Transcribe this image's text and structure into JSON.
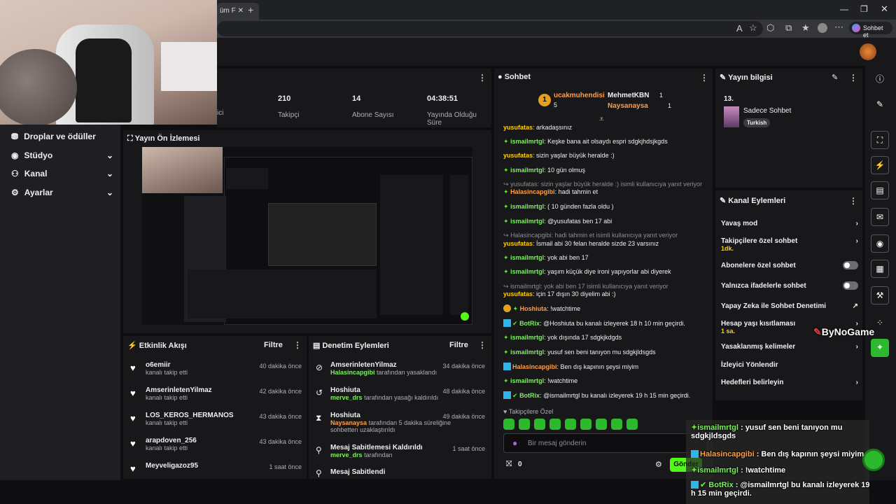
{
  "browser": {
    "tab_label": "üm F",
    "search_label": "Sohbet et"
  },
  "stream_stats": {
    "title_fragment": "ici",
    "items": [
      {
        "value": "210",
        "label": "Takipçi"
      },
      {
        "value": "14",
        "label": "Abone Sayısı"
      },
      {
        "value": "04:38:51",
        "label": "Yayında Olduğu Süre"
      }
    ]
  },
  "sidebar": {
    "items": [
      {
        "label": "Droplar ve ödüller"
      },
      {
        "label": "Stüdyo"
      },
      {
        "label": "Kanal"
      },
      {
        "label": "Ayarlar"
      }
    ]
  },
  "preview": {
    "title": "Yayın Ön İzlemesi"
  },
  "activity": {
    "title": "Etkinlik Akışı",
    "filter": "Filtre",
    "items": [
      {
        "name": "o6emiir",
        "sub": "kanalı takip etti",
        "time": "40 dakika önce"
      },
      {
        "name": "AmserinletenYilmaz",
        "sub": "kanalı takip etti",
        "time": "42 dakika önce"
      },
      {
        "name": "LOS_KEROS_HERMANOS",
        "sub": "kanalı takip etti",
        "time": "43 dakika önce"
      },
      {
        "name": "arapdoven_256",
        "sub": "kanalı takip etti",
        "time": "43 dakika önce"
      },
      {
        "name": "Meyveligazoz95",
        "sub": "kanalı takip etti",
        "time": "1 saat önce"
      }
    ]
  },
  "moderation": {
    "title": "Denetim Eylemleri",
    "filter": "Filtre",
    "items": [
      {
        "name": "AmserinletenYilmaz",
        "by": "Halasincapgibi",
        "sub": "tarafından yasaklandı",
        "time": "34 dakika önce"
      },
      {
        "name": "Hoshiuta",
        "by": "merve_drs",
        "sub": "tarafından yasağı kaldırıldı",
        "time": "48 dakika önce"
      },
      {
        "name": "Hoshiuta",
        "by": "Naysanaysa",
        "sub": "tarafından 5 dakika süreliğine sohbetten uzaklaştırıldı",
        "time": "49 dakika önce"
      },
      {
        "name": "Mesaj Sabitlemesi Kaldırıldı",
        "by": "merve_drs",
        "sub": "tarafından",
        "time": "1 saat önce"
      },
      {
        "name": "Mesaj Sabitlendi",
        "by": "",
        "sub": "",
        "time": ""
      }
    ]
  },
  "chat": {
    "title": "Sohbet",
    "leaders": [
      {
        "name": "ucakmuhendisi",
        "count": "5"
      },
      {
        "name": "MehmetKBN",
        "count": "1"
      },
      {
        "name": "Naysanaysa",
        "count": "1"
      }
    ],
    "messages": [
      {
        "user": "yusufatas",
        "text": "arkadaşsınız"
      },
      {
        "user": "ismailmrtgl",
        "text": "Keşke bana ait olsaydı espri sdgkjhdsjkgds"
      },
      {
        "user": "yusufatas",
        "text": "sizin yaşlar büyük heralde :)"
      },
      {
        "user": "ismailmrtgl",
        "text": "10 gün olmuş"
      },
      {
        "reply": "yusufatas: sizin yaşlar büyük heralde :) isimli kullanıcıya yanıt veriyor"
      },
      {
        "user": "Halasincapgibi",
        "text": "hadi tahmin et"
      },
      {
        "user": "ismailmrtgl",
        "text": "( 10 günden fazla oldu )"
      },
      {
        "user": "ismailmrtgl",
        "text": "@yusufatas ben 17 abi"
      },
      {
        "reply": "Halasincapgibi: hadi tahmin et isimli kullanıcıya yanıt veriyor"
      },
      {
        "user": "yusufatas",
        "text": "İsmail abi 30 felan heralde sizde 23 varsınız"
      },
      {
        "user": "ismailmrtgl",
        "text": "yok abi ben 17"
      },
      {
        "user": "ismailmrtgl",
        "text": "yaşım küçük diye ironi yapıyorlar abi diyerek"
      },
      {
        "reply": "ismailmrtgl: yok abi ben 17 isimli kullanıcıya yanıt veriyor"
      },
      {
        "user": "yusufatas",
        "text": "için 17 dışın 30 diyelim abi :)"
      },
      {
        "user": "Hoshiuta",
        "text": "!watchtime"
      },
      {
        "user": "BotRix",
        "text": "@Hoshiuta bu kanalı izleyerek 18 h 10 min geçirdi."
      },
      {
        "user": "ismailmrtgl",
        "text": "yok dışında 17 sdgkjkdgds"
      },
      {
        "user": "ismailmrtgl",
        "text": "yusuf sen beni tanıyon mu sdgkjldsgds"
      },
      {
        "user": "Halasincapgibi",
        "text": "Ben dış kapının şeysi miyim"
      },
      {
        "user": "ismailmrtgl",
        "text": "!watchtime"
      },
      {
        "user": "BotRix",
        "text": "@ismailmrtgl bu kanalı izleyerek 19 h 15 min geçirdi."
      }
    ],
    "followers_only": "Takipçilere Özel",
    "input_placeholder": "Bir mesaj gönderin",
    "points": "0",
    "send": "Gönder"
  },
  "stream_info": {
    "title": "Yayın bilgisi",
    "number": "13.",
    "category": "Sadece Sohbet",
    "tag": "Turkish"
  },
  "channel_actions": {
    "title": "Kanal Eylemleri",
    "items": [
      {
        "label": "Yavaş mod",
        "sub": ""
      },
      {
        "label": "Takipçilere özel sohbet",
        "sub": "1dk."
      },
      {
        "label": "Abonelere özel sohbet",
        "sub": ""
      },
      {
        "label": "Yalnızca ifadelerle sohbet",
        "sub": ""
      },
      {
        "label": "Yapay Zeka ile Sohbet Denetimi",
        "sub": ""
      },
      {
        "label": "Hesap yaşı kısıtlaması",
        "sub": "1 sa."
      },
      {
        "label": "Yasaklanmış kelimeler",
        "sub": ""
      },
      {
        "label": "İzleyici Yönlendir",
        "sub": ""
      },
      {
        "label": "Hedefleri belirleyin",
        "sub": ""
      }
    ]
  },
  "overlay": {
    "brand": "ByNoGame",
    "lines": [
      {
        "user": "ismailmrtgl",
        "text": ": yusuf sen beni tanıyon mu sdgkjldsgds"
      },
      {
        "user": "Halasincapgibi",
        "text": ": Ben dış kapının şeysi miyim"
      },
      {
        "user": "ismailmrtgl",
        "text": ": !watchtime"
      },
      {
        "user": "BotRix",
        "text": ": @ismailmrtgl bu kanalı izleyerek 19 h 15 min geçirdi."
      }
    ]
  },
  "colors": {
    "accent": "#53fc18",
    "bg": "#0e0e10",
    "panel": "#18181b"
  }
}
